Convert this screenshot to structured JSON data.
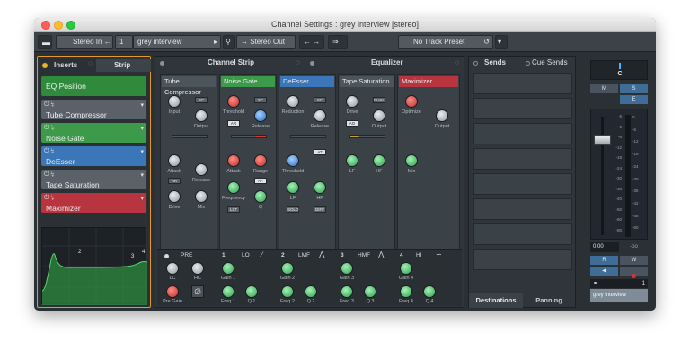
{
  "window": {
    "title": "Channel Settings : grey interview [stereo]"
  },
  "toolbar": {
    "input": "Stereo In",
    "channel_number": "1",
    "channel_name": "grey interview",
    "output": "Stereo Out",
    "track_preset": "No Track Preset"
  },
  "left_panel": {
    "tab_inserts": "Inserts",
    "tab_strip": "Strip",
    "eq_position": "EQ Position",
    "items": [
      {
        "label": "Tube Compressor"
      },
      {
        "label": "Noise Gate"
      },
      {
        "label": "DeEsser"
      },
      {
        "label": "Tape Saturation"
      },
      {
        "label": "Maximizer"
      }
    ],
    "curve_points": [
      "2",
      "3",
      "4"
    ]
  },
  "channel_strip": {
    "header": "Channel Strip",
    "eq_header": "Equalizer",
    "modules": [
      {
        "title": "Tube Compressor",
        "k": [
          "Input",
          "Output",
          "Attack",
          "Release",
          "Drive",
          "Mix"
        ],
        "b": [
          "SC",
          "AR"
        ]
      },
      {
        "title": "Noise Gate",
        "k": [
          "Threshold",
          "Release",
          "Attack",
          "Range",
          "Frequency",
          "Q"
        ],
        "b": [
          "SC",
          "AR",
          "AF",
          "LST"
        ]
      },
      {
        "title": "DeEsser",
        "k": [
          "Reduction",
          "Release",
          "Threshold",
          "LF",
          "HF"
        ],
        "b": [
          "SC",
          "AT",
          "SOLO",
          "DIFF"
        ]
      },
      {
        "title": "Tape Saturation",
        "k": [
          "Drive",
          "Output",
          "LF",
          "HF"
        ],
        "b": [
          "DUAL",
          "AG"
        ]
      },
      {
        "title": "Maximizer",
        "k": [
          "Optimize",
          "Output",
          "Mix"
        ],
        "b": []
      }
    ],
    "eq": {
      "pre": "PRE",
      "bands": [
        {
          "num": "1",
          "type": "LO"
        },
        {
          "num": "2",
          "type": "LMF"
        },
        {
          "num": "3",
          "type": "HMF"
        },
        {
          "num": "4",
          "type": "HI"
        }
      ],
      "pre_labels": [
        "LC",
        "HC",
        "Pre Gain"
      ],
      "gain": [
        "Gain 1",
        "Gain 2",
        "Gain 3",
        "Gain 4"
      ],
      "freq": [
        "Freq 1",
        "Freq 2",
        "Freq 3",
        "Freq 4"
      ],
      "q": [
        "Q 1",
        "Q 2",
        "Q 3",
        "Q 4"
      ]
    }
  },
  "sends": {
    "tab_sends": "Sends",
    "tab_cue": "Cue Sends",
    "destinations": "Destinations",
    "panning": "Panning"
  },
  "fader": {
    "pan": "C",
    "m": "M",
    "s": "S",
    "e": "E",
    "r": "R",
    "w": "W",
    "volume": "0.00",
    "peak": "-oo",
    "channel_num": "1",
    "channel_name": "grey interview",
    "scale": [
      "6",
      "0",
      "-6",
      "-12",
      "-18",
      "-24",
      "-30",
      "-36",
      "-40",
      "-50",
      "-60",
      "-80"
    ],
    "meter_scale": [
      "0",
      "-6",
      "-12",
      "-18",
      "-24",
      "-30",
      "-36",
      "-42",
      "-48",
      "-60"
    ]
  },
  "colors": {
    "accent_orange": "#e39a2c",
    "insert_green": "#3d9a4a",
    "insert_blue": "#3a76b8",
    "insert_red": "#b8343e",
    "panel": "#2f353b"
  }
}
